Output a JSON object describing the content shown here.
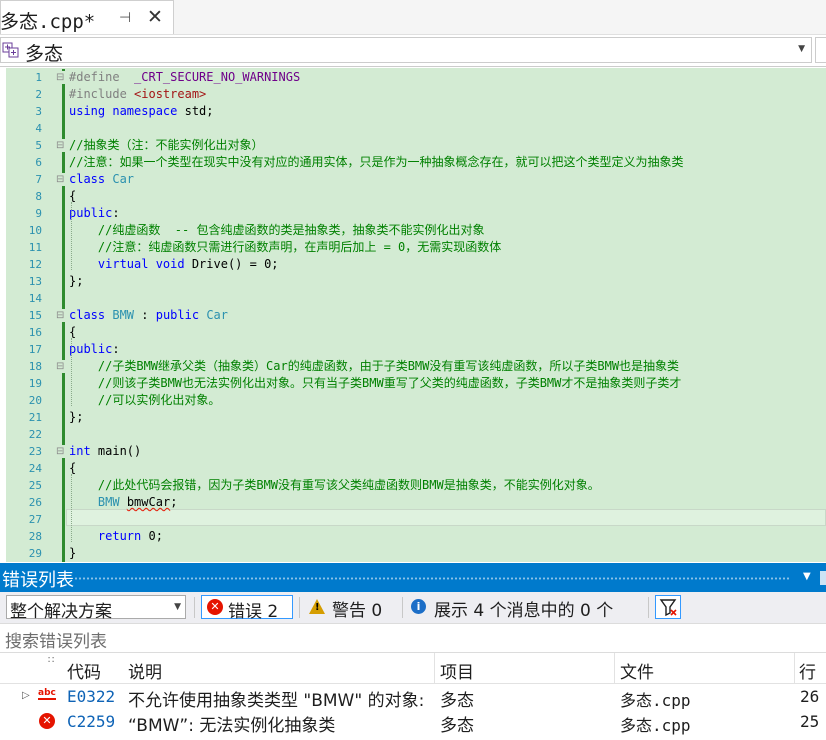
{
  "tab": {
    "title": "多态.cpp*",
    "pin_glyph": "⊣",
    "close_glyph": "✕"
  },
  "navbar": {
    "scope": "多态"
  },
  "editor": {
    "lines": [
      {
        "n": "1",
        "fold": "⊟",
        "spans": [
          {
            "c": "pp",
            "t": "#define  "
          },
          {
            "c": "mac",
            "t": "_CRT_SECURE_NO_WARNINGS"
          }
        ]
      },
      {
        "n": "2",
        "fold": "",
        "spans": [
          {
            "c": "pp",
            "t": "#include "
          },
          {
            "c": "str",
            "t": "<iostream>"
          }
        ]
      },
      {
        "n": "3",
        "fold": "",
        "spans": [
          {
            "c": "kw",
            "t": "using namespace "
          },
          {
            "c": "tx",
            "t": "std;"
          }
        ]
      },
      {
        "n": "4",
        "fold": "",
        "spans": []
      },
      {
        "n": "5",
        "fold": "⊟",
        "spans": [
          {
            "c": "cm",
            "t": "//抽象类（注：不能实例化出对象）"
          }
        ]
      },
      {
        "n": "6",
        "fold": "",
        "spans": [
          {
            "c": "cm",
            "t": "//注意：如果一个类型在现实中没有对应的通用实体，只是作为一种抽象概念存在，就可以把这个类型定义为抽象类"
          }
        ]
      },
      {
        "n": "7",
        "fold": "⊟",
        "spans": [
          {
            "c": "kw",
            "t": "class "
          },
          {
            "c": "ty",
            "t": "Car"
          }
        ]
      },
      {
        "n": "8",
        "fold": "",
        "spans": [
          {
            "c": "tx",
            "t": "{"
          }
        ]
      },
      {
        "n": "9",
        "fold": "",
        "spans": [
          {
            "c": "kw",
            "t": "public"
          },
          {
            "c": "tx",
            "t": ":"
          }
        ]
      },
      {
        "n": "10",
        "fold": "",
        "spans": [
          {
            "c": "tx",
            "t": "    "
          },
          {
            "c": "cm",
            "t": "//纯虚函数  -- 包含纯虚函数的类是抽象类，抽象类不能实例化出对象"
          }
        ]
      },
      {
        "n": "11",
        "fold": "",
        "spans": [
          {
            "c": "tx",
            "t": "    "
          },
          {
            "c": "cm",
            "t": "//注意：纯虚函数只需进行函数声明，在声明后加上 = 0，无需实现函数体"
          }
        ]
      },
      {
        "n": "12",
        "fold": "",
        "spans": [
          {
            "c": "tx",
            "t": "    "
          },
          {
            "c": "kw",
            "t": "virtual void "
          },
          {
            "c": "tx",
            "t": "Drive() = 0;"
          }
        ]
      },
      {
        "n": "13",
        "fold": "",
        "spans": [
          {
            "c": "tx",
            "t": "};"
          }
        ]
      },
      {
        "n": "14",
        "fold": "",
        "spans": []
      },
      {
        "n": "15",
        "fold": "⊟",
        "spans": [
          {
            "c": "kw",
            "t": "class "
          },
          {
            "c": "ty",
            "t": "BMW"
          },
          {
            "c": "tx",
            "t": " : "
          },
          {
            "c": "kw",
            "t": "public "
          },
          {
            "c": "ty",
            "t": "Car"
          }
        ]
      },
      {
        "n": "16",
        "fold": "",
        "spans": [
          {
            "c": "tx",
            "t": "{"
          }
        ]
      },
      {
        "n": "17",
        "fold": "",
        "spans": [
          {
            "c": "kw",
            "t": "public"
          },
          {
            "c": "tx",
            "t": ":"
          }
        ]
      },
      {
        "n": "18",
        "fold": "⊟",
        "spans": [
          {
            "c": "tx",
            "t": "    "
          },
          {
            "c": "cm",
            "t": "//子类BMW继承父类（抽象类）Car的纯虚函数，由于子类BMW没有重写该纯虚函数，所以子类BMW也是抽象类"
          }
        ]
      },
      {
        "n": "19",
        "fold": "",
        "spans": [
          {
            "c": "tx",
            "t": "    "
          },
          {
            "c": "cm",
            "t": "//则该子类BMW也无法实例化出对象。只有当子类BMW重写了父类的纯虚函数，子类BMW才不是抽象类则子类才"
          }
        ]
      },
      {
        "n": "20",
        "fold": "",
        "spans": [
          {
            "c": "tx",
            "t": "    "
          },
          {
            "c": "cm",
            "t": "//可以实例化出对象。"
          }
        ]
      },
      {
        "n": "21",
        "fold": "",
        "spans": [
          {
            "c": "tx",
            "t": "};"
          }
        ]
      },
      {
        "n": "22",
        "fold": "",
        "spans": []
      },
      {
        "n": "23",
        "fold": "⊟",
        "spans": [
          {
            "c": "kw",
            "t": "int "
          },
          {
            "c": "tx",
            "t": "main()"
          }
        ]
      },
      {
        "n": "24",
        "fold": "",
        "spans": [
          {
            "c": "tx",
            "t": "{"
          }
        ]
      },
      {
        "n": "25",
        "fold": "",
        "spans": [
          {
            "c": "tx",
            "t": "    "
          },
          {
            "c": "cm",
            "t": "//此处代码会报错，因为子类BMW没有重写该父类纯虚函数则BMW是抽象类，不能实例化对象。"
          }
        ]
      },
      {
        "n": "26",
        "fold": "",
        "spans": [
          {
            "c": "tx",
            "t": "    "
          },
          {
            "c": "ty",
            "t": "BMW"
          },
          {
            "c": "tx",
            "t": " "
          },
          {
            "c": "tx squig",
            "t": "bmwCar"
          },
          {
            "c": "tx",
            "t": ";"
          }
        ]
      },
      {
        "n": "27",
        "fold": "",
        "spans": []
      },
      {
        "n": "28",
        "fold": "",
        "spans": [
          {
            "c": "tx",
            "t": "    "
          },
          {
            "c": "kw",
            "t": "return "
          },
          {
            "c": "tx",
            "t": "0;"
          }
        ]
      },
      {
        "n": "29",
        "fold": "",
        "spans": [
          {
            "c": "tx",
            "t": "}"
          }
        ]
      }
    ]
  },
  "error_list": {
    "title": "错误列表",
    "scope_value": "整个解决方案",
    "errors_button": "错误 2",
    "warnings_button": "警告 0",
    "messages_button": "展示 4 个消息中的 0 个",
    "search_placeholder": "搜索错误列表",
    "columns": {
      "code": "代码",
      "description": "说明",
      "project": "项目",
      "file": "文件",
      "line": "行"
    },
    "rows": [
      {
        "code": "E0322",
        "description": "不允许使用抽象类类型 \"BMW\" 的对象:",
        "project": "多态",
        "file": "多态.cpp",
        "line": "26"
      },
      {
        "code": "C2259",
        "description": "“BMW”: 无法实例化抽象类",
        "project": "多态",
        "file": "多态.cpp",
        "line": "25"
      }
    ]
  },
  "colors": {
    "accent": "#007acc",
    "error": "#e51400",
    "warning": "#d59d00",
    "info": "#1c6ec7",
    "editor_tint": "#d3ebd3"
  }
}
